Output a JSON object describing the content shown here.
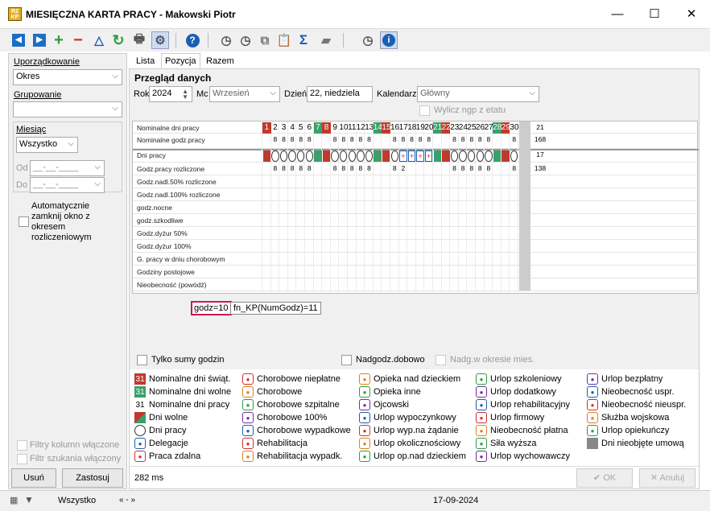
{
  "window": {
    "title": "MIESIĘCZNA KARTA PRACY - Makowski Piotr",
    "minimize": "—",
    "maximize": "☐",
    "close": "✕"
  },
  "left": {
    "sort_label": "Uporządkowanie",
    "sort_value": "Okres",
    "group_label": "Grupowanie",
    "group_value": "",
    "month_label": "Miesiąc",
    "month_value": "Wszystko",
    "od_label": "Od",
    "od_value": "__-__-____",
    "do_label": "Do",
    "do_value": "__-__-____",
    "auto_close": "Automatycznie zamknij okno z okresem rozliczeniowym",
    "filters_on": "Filtry kolumn włączone",
    "search_filter_on": "Filtr szukania włączony",
    "delete_btn": "Usuń",
    "apply_btn": "Zastosuj"
  },
  "tabs": [
    "Lista",
    "Pozycja",
    "Razem"
  ],
  "overview": {
    "title": "Przegląd danych",
    "year_label": "Rok",
    "year": "2024",
    "month_label": "Mc",
    "month": "Wrzesień",
    "day_label": "Dzień",
    "day": "22, niedziela",
    "calendar_label": "Kalendarz",
    "calendar": "Główny",
    "calc_ngp": "Wylicz ngp z etatu"
  },
  "grid": {
    "rows": [
      "Nominalne dni pracy",
      "Nominalne godz.pracy",
      "Dni pracy",
      "Godz.pracy rozliczone",
      "Godz.nadl.50% rozliczone",
      "Godz.nadl.100% rozliczone",
      "godz.nocne",
      "godz.szkodliwe",
      "Godz.dyżur 50%",
      "Godz.dyżur 100%",
      "G. pracy w dniu chorobowym",
      "Godziny postojowe",
      "Nieobecność (powódź)"
    ],
    "days": [
      "1",
      "2",
      "3",
      "4",
      "5",
      "6",
      "7",
      "8",
      "9",
      "10",
      "11",
      "12",
      "13",
      "14",
      "15",
      "16",
      "17",
      "18",
      "19",
      "20",
      "21",
      "22",
      "23",
      "24",
      "25",
      "26",
      "27",
      "28",
      "29",
      "30"
    ],
    "day_types": [
      "r",
      "n",
      "n",
      "n",
      "n",
      "n",
      "g",
      "r",
      "n",
      "n",
      "n",
      "n",
      "n",
      "g",
      "r",
      "n",
      "n",
      "n",
      "n",
      "n",
      "g",
      "r",
      "n",
      "n",
      "n",
      "n",
      "n",
      "g",
      "r",
      "n"
    ],
    "nominal_hours": [
      "",
      "8",
      "8",
      "8",
      "8",
      "8",
      "",
      "",
      "8",
      "8",
      "8",
      "8",
      "8",
      "",
      "",
      "8",
      "8",
      "8",
      "8",
      "8",
      "",
      "",
      "8",
      "8",
      "8",
      "8",
      "8",
      "",
      "",
      "8"
    ],
    "work_types": [
      "R",
      "C",
      "C",
      "C",
      "C",
      "C",
      "G",
      "R",
      "C",
      "C",
      "C",
      "C",
      "C",
      "G",
      "R",
      "C",
      "P",
      "P",
      "P",
      "P",
      "G",
      "R",
      "C",
      "C",
      "C",
      "C",
      "C",
      "G",
      "R",
      "C"
    ],
    "worked_hours": [
      "",
      "8",
      "8",
      "8",
      "8",
      "8",
      "",
      "",
      "8",
      "8",
      "8",
      "8",
      "8",
      "",
      "",
      "8",
      "2",
      "",
      "",
      "",
      "",
      "",
      "8",
      "8",
      "8",
      "8",
      "8",
      "",
      "",
      "8"
    ],
    "totals": [
      "21",
      "168",
      "17",
      "138"
    ]
  },
  "formula": {
    "godz": "godz=10",
    "fn": "fn_KP(NumGodz)=11"
  },
  "options": {
    "sums_only": "Tylko sumy godzin",
    "overtime_daily": "Nadgodz.dobowo",
    "overtime_monthly": "Nadg.w okresie mies."
  },
  "legend": [
    [
      "Nominalne dni świąt.",
      "Nominalne dni wolne",
      "Nominalne dni pracy",
      "Dni wolne",
      "Dni pracy",
      "Delegacje",
      "Praca zdalna"
    ],
    [
      "Chorobowe niepłatne",
      "Chorobowe",
      "Chorobowe szpitalne",
      "Chorobowe 100%",
      "Chorobowe wypadkowe",
      "Rehabilitacja",
      "Rehabilitacja wypadk."
    ],
    [
      "Opieka nad dzieckiem",
      "Opieka inne",
      "Ojcowski",
      "Urlop wypoczynkowy",
      "Urlop wyp.na żądanie",
      "Urlop okolicznościowy",
      "Urlop op.nad dzieckiem"
    ],
    [
      "Urlop szkoleniowy",
      "Urlop dodatkowy",
      "Urlop rehabilitacyjny",
      "Urlop firmowy",
      "Nieobecność płatna",
      "Siła wyższa",
      "Urlop wychowawczy"
    ],
    [
      "Urlop bezpłatny",
      "Nieobecność uspr.",
      "Nieobecność nieuspr.",
      "Służba wojskowa",
      "Urlop opiekuńczy",
      "Dni nieobjęte umową"
    ]
  ],
  "legend_sample_num": "31",
  "bottom": {
    "time": "282 ms",
    "ok": "OK",
    "cancel": "Anuluj"
  },
  "status": {
    "filter": "Wszystko",
    "nav": "« -  »",
    "date": "17-09-2024"
  },
  "colors": {
    "holiday": "#c0392b",
    "free": "#3aa06a",
    "work_blue": "#1a5fb4"
  }
}
